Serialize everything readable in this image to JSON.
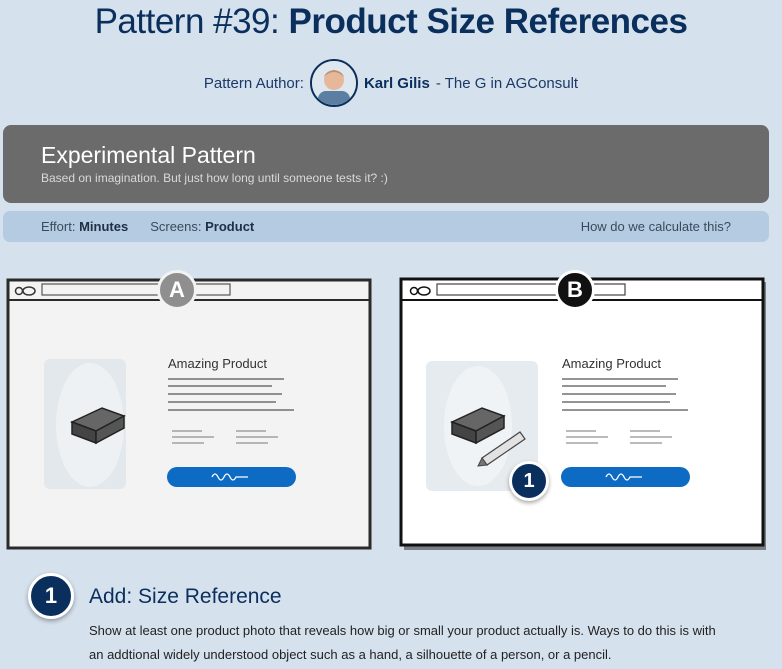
{
  "title": {
    "prefix": "Pattern #39:",
    "bold": "Product Size References"
  },
  "author": {
    "label": "Pattern Author:",
    "name": "Karl Gilis",
    "affiliation": "- The G in AGConsult"
  },
  "experimental": {
    "title": "Experimental Pattern",
    "subtitle": "Based on imagination. But just how long until someone tests it? :)"
  },
  "meta": {
    "effort_label": "Effort:",
    "effort_value": "Minutes",
    "screens_label": "Screens:",
    "screens_value": "Product",
    "calc_link": "How do we calculate this?"
  },
  "variants": {
    "a": {
      "badge": "A",
      "product_title": "Amazing Product",
      "badge_color": "#8f8f8f"
    },
    "b": {
      "badge": "B",
      "product_title": "Amazing Product",
      "marker": "1",
      "badge_color": "#111111"
    }
  },
  "addition": {
    "number": "1",
    "title": "Add: Size Reference",
    "body": "Show at least one product photo that reveals how big or small your product actually is. Ways to do this is with an addtional widely understood object such as a hand, a silhouette of a person, or a pencil."
  },
  "colors": {
    "background": "#d6e1ee",
    "navy": "#0b2f5c",
    "button_blue": "#0d6bc4",
    "experimental_bg": "#6b6b6b",
    "meta_bg": "#b4cbe2"
  }
}
